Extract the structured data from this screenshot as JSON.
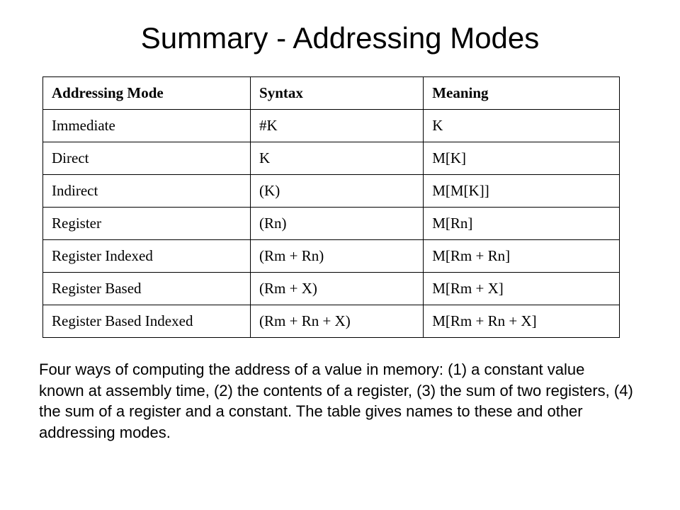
{
  "title": "Summary - Addressing Modes",
  "table": {
    "headers": [
      "Addressing Mode",
      "Syntax",
      "Meaning"
    ],
    "rows": [
      {
        "mode": "Immediate",
        "syntax": "#K",
        "meaning": "K"
      },
      {
        "mode": "Direct",
        "syntax": "K",
        "meaning": "M[K]"
      },
      {
        "mode": "Indirect",
        "syntax": "(K)",
        "meaning": "M[M[K]]"
      },
      {
        "mode": "Register",
        "syntax": "(Rn)",
        "meaning": "M[Rn]"
      },
      {
        "mode": "Register Indexed",
        "syntax": "(Rm + Rn)",
        "meaning": "M[Rm + Rn]"
      },
      {
        "mode": "Register Based",
        "syntax": "(Rm + X)",
        "meaning": "M[Rm + X]"
      },
      {
        "mode": "Register Based Indexed",
        "syntax": "(Rm + Rn + X)",
        "meaning": "M[Rm + Rn + X]"
      }
    ]
  },
  "footer": "Four ways of computing the address of a value in memory: (1) a constant value known at assembly time, (2) the contents of a register, (3) the sum of two registers, (4) the sum of a register and a constant. The table gives names to these and other addressing modes."
}
